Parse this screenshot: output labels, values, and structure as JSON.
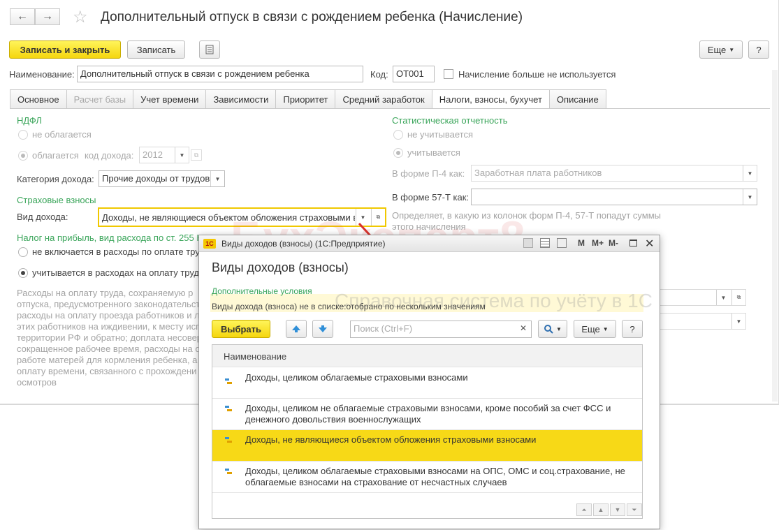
{
  "window": {
    "title": "Дополнительный отпуск в связи с рождением ребенка (Начисление)",
    "back_icon": "←",
    "forward_icon": "→",
    "star_icon": "☆"
  },
  "toolbar": {
    "save_close": "Записать и закрыть",
    "save": "Записать",
    "more": "Еще",
    "help": "?"
  },
  "header": {
    "name_label": "Наименование:",
    "name_value": "Дополнительный отпуск в связи с рождением ребенка",
    "code_label": "Код:",
    "code_value": "ОТ001",
    "unused_label": "Начисление больше не используется"
  },
  "tabs": [
    {
      "label": "Основное"
    },
    {
      "label": "Расчет базы"
    },
    {
      "label": "Учет времени"
    },
    {
      "label": "Зависимости"
    },
    {
      "label": "Приоритет"
    },
    {
      "label": "Средний заработок"
    },
    {
      "label": "Налоги, взносы, бухучет"
    },
    {
      "label": "Описание"
    }
  ],
  "ndfl": {
    "heading": "НДФЛ",
    "not_taxed": "не облагается",
    "taxed": "облагается",
    "income_code_label": "код дохода:",
    "income_code_value": "2012",
    "category_label": "Категория дохода:",
    "category_value": "Прочие доходы от трудов"
  },
  "insurance": {
    "heading": "Страховые взносы",
    "income_type_label": "Вид дохода:",
    "income_type_value": "Доходы, не являющиеся объектом обложения страховыми в"
  },
  "profit_tax": {
    "heading": "Налог на прибыль, вид расхода по ст. 255 НК РФ",
    "option1": "не включается в расходы по оплате тру",
    "option2": "учитывается в расходах на оплату труд",
    "description_lines": [
      "Расходы на оплату труда, сохраняемую р",
      "отпуска, предусмотренного законодательст",
      "расходы на оплату проезда работников и л",
      "этих работников на иждивении, к месту исп",
      "территории РФ и обратно; доплата несовер",
      "сокращенное рабочее время, расходы на о",
      "работе матерей для кормления ребенка, а т",
      "оплату времени, связанного с прохождени",
      "осмотров"
    ]
  },
  "stats": {
    "heading": "Статистическая отчетность",
    "not_counted": "не учитывается",
    "counted": "учитывается",
    "p4_label": "В форме П-4 как:",
    "p4_value": "Заработная плата работников",
    "f57_label": "В форме 57-Т как:",
    "f57_value": "",
    "hint_line1": "Определяет, в какую из колонок форм П-4, 57-Т попадут суммы",
    "hint_line2": "этого начисления"
  },
  "watermark": {
    "brand": "БухЭксперт8",
    "tagline": "Справочная система по учёту в 1С"
  },
  "popup": {
    "app_icon": "1С",
    "window_title": "Виды доходов (взносы)  (1С:Предприятие)",
    "heading": "Виды доходов (взносы)",
    "conditions_label": "Дополнительные условия",
    "conditions_text": "Виды дохода (взноса) не в списке:отобрано по нескольким значениям",
    "select_button": "Выбрать",
    "search_placeholder": "Поиск (Ctrl+F)",
    "more": "Еще",
    "help": "?",
    "m_label": "M",
    "mplus_label": "M+",
    "mminus_label": "M-",
    "column_header": "Наименование",
    "rows": [
      {
        "text": "Доходы, целиком облагаемые страховыми взносами"
      },
      {
        "text": "Доходы, целиком не облагаемые страховыми взносами, кроме пособий за счет ФСС и",
        "text2": "денежного довольствия военнослужащих"
      },
      {
        "text": "Доходы, не являющиеся объектом обложения страховыми взносами",
        "selected": true
      },
      {
        "text": "Доходы, целиком облагаемые страховыми взносами на ОПС, ОМС и соц.страхование, не",
        "text2": "облагаемые взносами на страхование от несчастных случаев"
      }
    ]
  },
  "colors": {
    "accent_yellow": "#f5d60e",
    "selection_yellow": "#f7d917",
    "section_green": "#3aa55a",
    "arrow_red": "#d9322d"
  }
}
